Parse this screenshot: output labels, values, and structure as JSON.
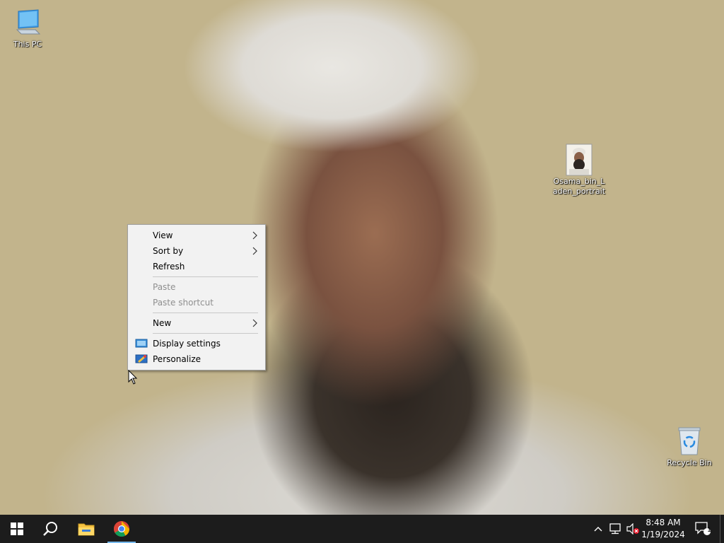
{
  "desktop": {
    "icons": [
      {
        "label": "This PC",
        "icon": "monitor-icon"
      },
      {
        "label": "Osama_bin_Laden_portrait",
        "icon": "image-file-icon"
      },
      {
        "label": "Recycle Bin",
        "icon": "recycle-bin-icon"
      }
    ]
  },
  "context_menu": {
    "items": [
      {
        "label": "View",
        "submenu": true,
        "enabled": true
      },
      {
        "label": "Sort by",
        "submenu": true,
        "enabled": true
      },
      {
        "label": "Refresh",
        "submenu": false,
        "enabled": true
      },
      {
        "label": "Paste",
        "submenu": false,
        "enabled": false
      },
      {
        "label": "Paste shortcut",
        "submenu": false,
        "enabled": false
      },
      {
        "label": "New",
        "submenu": true,
        "enabled": true
      },
      {
        "label": "Display settings",
        "submenu": false,
        "enabled": true,
        "icon": "display-settings-icon"
      },
      {
        "label": "Personalize",
        "submenu": false,
        "enabled": true,
        "icon": "personalize-icon"
      }
    ]
  },
  "taskbar": {
    "pinned": [
      "start-icon",
      "search-icon",
      "file-explorer-icon",
      "chrome-icon"
    ],
    "tray": {
      "time": "8:48 AM",
      "date": "1/19/2024",
      "notification_count": "1"
    }
  },
  "colors": {
    "taskbar": "#1c1c1c",
    "menu_bg": "#f2f2f2",
    "active_indicator": "#76b9ed"
  }
}
